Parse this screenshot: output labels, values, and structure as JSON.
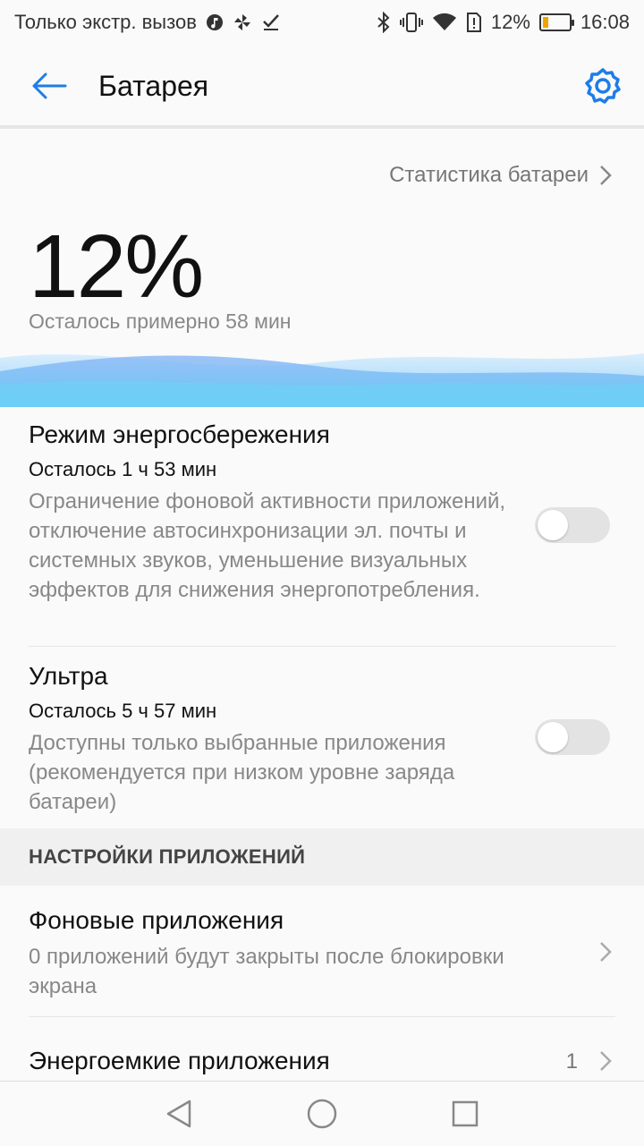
{
  "status_bar": {
    "carrier_text": "Только экстр. вызов",
    "battery_percent": "12%",
    "time": "16:08",
    "battery_level": 0.12,
    "icons": [
      "music-icon",
      "pinwheel-icon",
      "check-icon",
      "bluetooth-icon",
      "vibrate-icon",
      "wifi-icon",
      "alert-sim-icon"
    ]
  },
  "appbar": {
    "title": "Батарея"
  },
  "battery": {
    "stats_link": "Статистика батареи",
    "percent": "12%",
    "remaining": "Осталось примерно 58 мин"
  },
  "power_saving": {
    "title": "Режим энергосбережения",
    "remaining": "Осталось 1 ч 53 мин",
    "description": "Ограничение фоновой активности приложений, отключение автосинхронизации эл. почты и системных звуков, уменьшение визуальных эффектов для снижения энергопотребления.",
    "enabled": false
  },
  "ultra": {
    "title": "Ультра",
    "remaining": "Осталось 5 ч 57 мин",
    "description": "Доступны только выбранные приложения (рекомендуется при низком уровне заряда батареи)",
    "enabled": false
  },
  "app_settings": {
    "header": "НАСТРОЙКИ ПРИЛОЖЕНИЙ",
    "background_apps": {
      "title": "Фоновые приложения",
      "description": "0 приложений будут закрыты после блокировки экрана"
    },
    "heavy_apps": {
      "title": "Энергоемкие приложения",
      "count": "1"
    }
  },
  "colors": {
    "accent": "#1e7ce8",
    "wave_light": "#cfe6fb",
    "wave_dark": "#5fb7f3"
  }
}
